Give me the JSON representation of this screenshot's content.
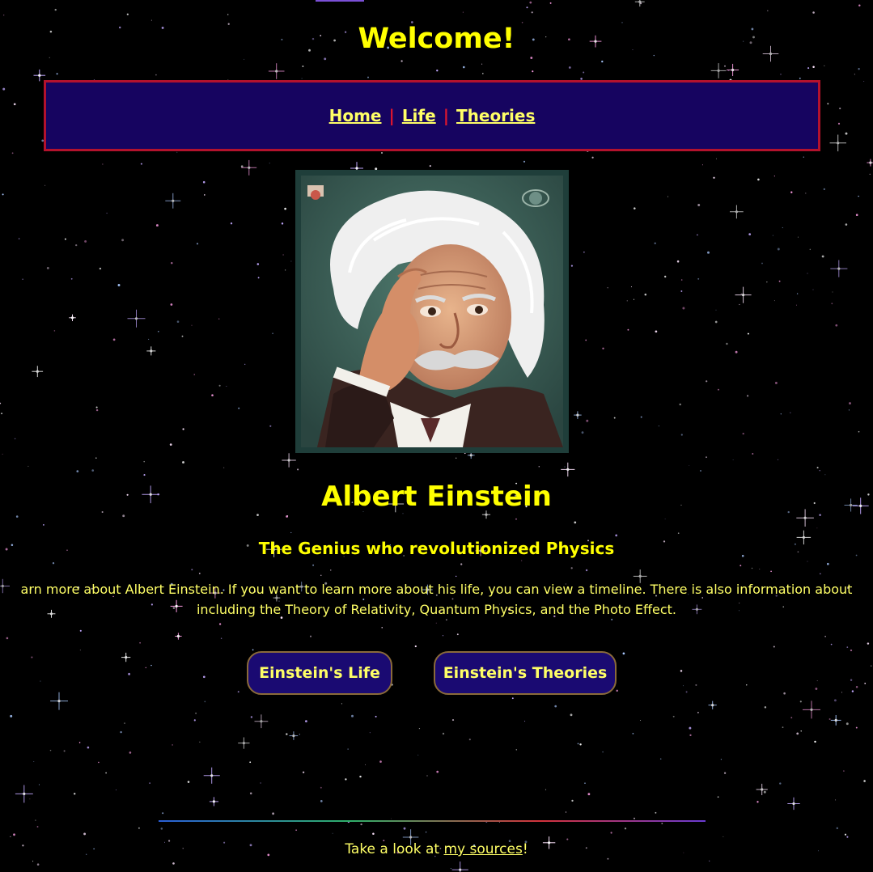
{
  "page": {
    "heading": "Welcome!"
  },
  "nav": {
    "links": [
      "Home",
      "Life",
      "Theories"
    ],
    "separator": "|"
  },
  "portrait": {
    "subject": "Albert Einstein portrait illustration"
  },
  "hero": {
    "name": "Albert Einstein",
    "tagline": "The Genius who revolutionized Physics",
    "intro_line1": "arn more about Albert Einstein. If you want to learn more about his life, you can view a timeline. There is also information about",
    "intro_line2": "including the Theory of Relativity, Quantum Physics, and the Photo Effect."
  },
  "buttons": {
    "life": "Einstein's Life",
    "theories": "Einstein's Theories"
  },
  "footer": {
    "prefix": "Take a look at ",
    "link": "my sources",
    "suffix": "!"
  },
  "colors": {
    "text": "#ffff00",
    "nav_bg": "#160460",
    "nav_border": "#b3122d",
    "separator": "#e0162e",
    "button_bg": "#1a0a72",
    "button_border": "#8a6a3a",
    "background": "#000000"
  }
}
